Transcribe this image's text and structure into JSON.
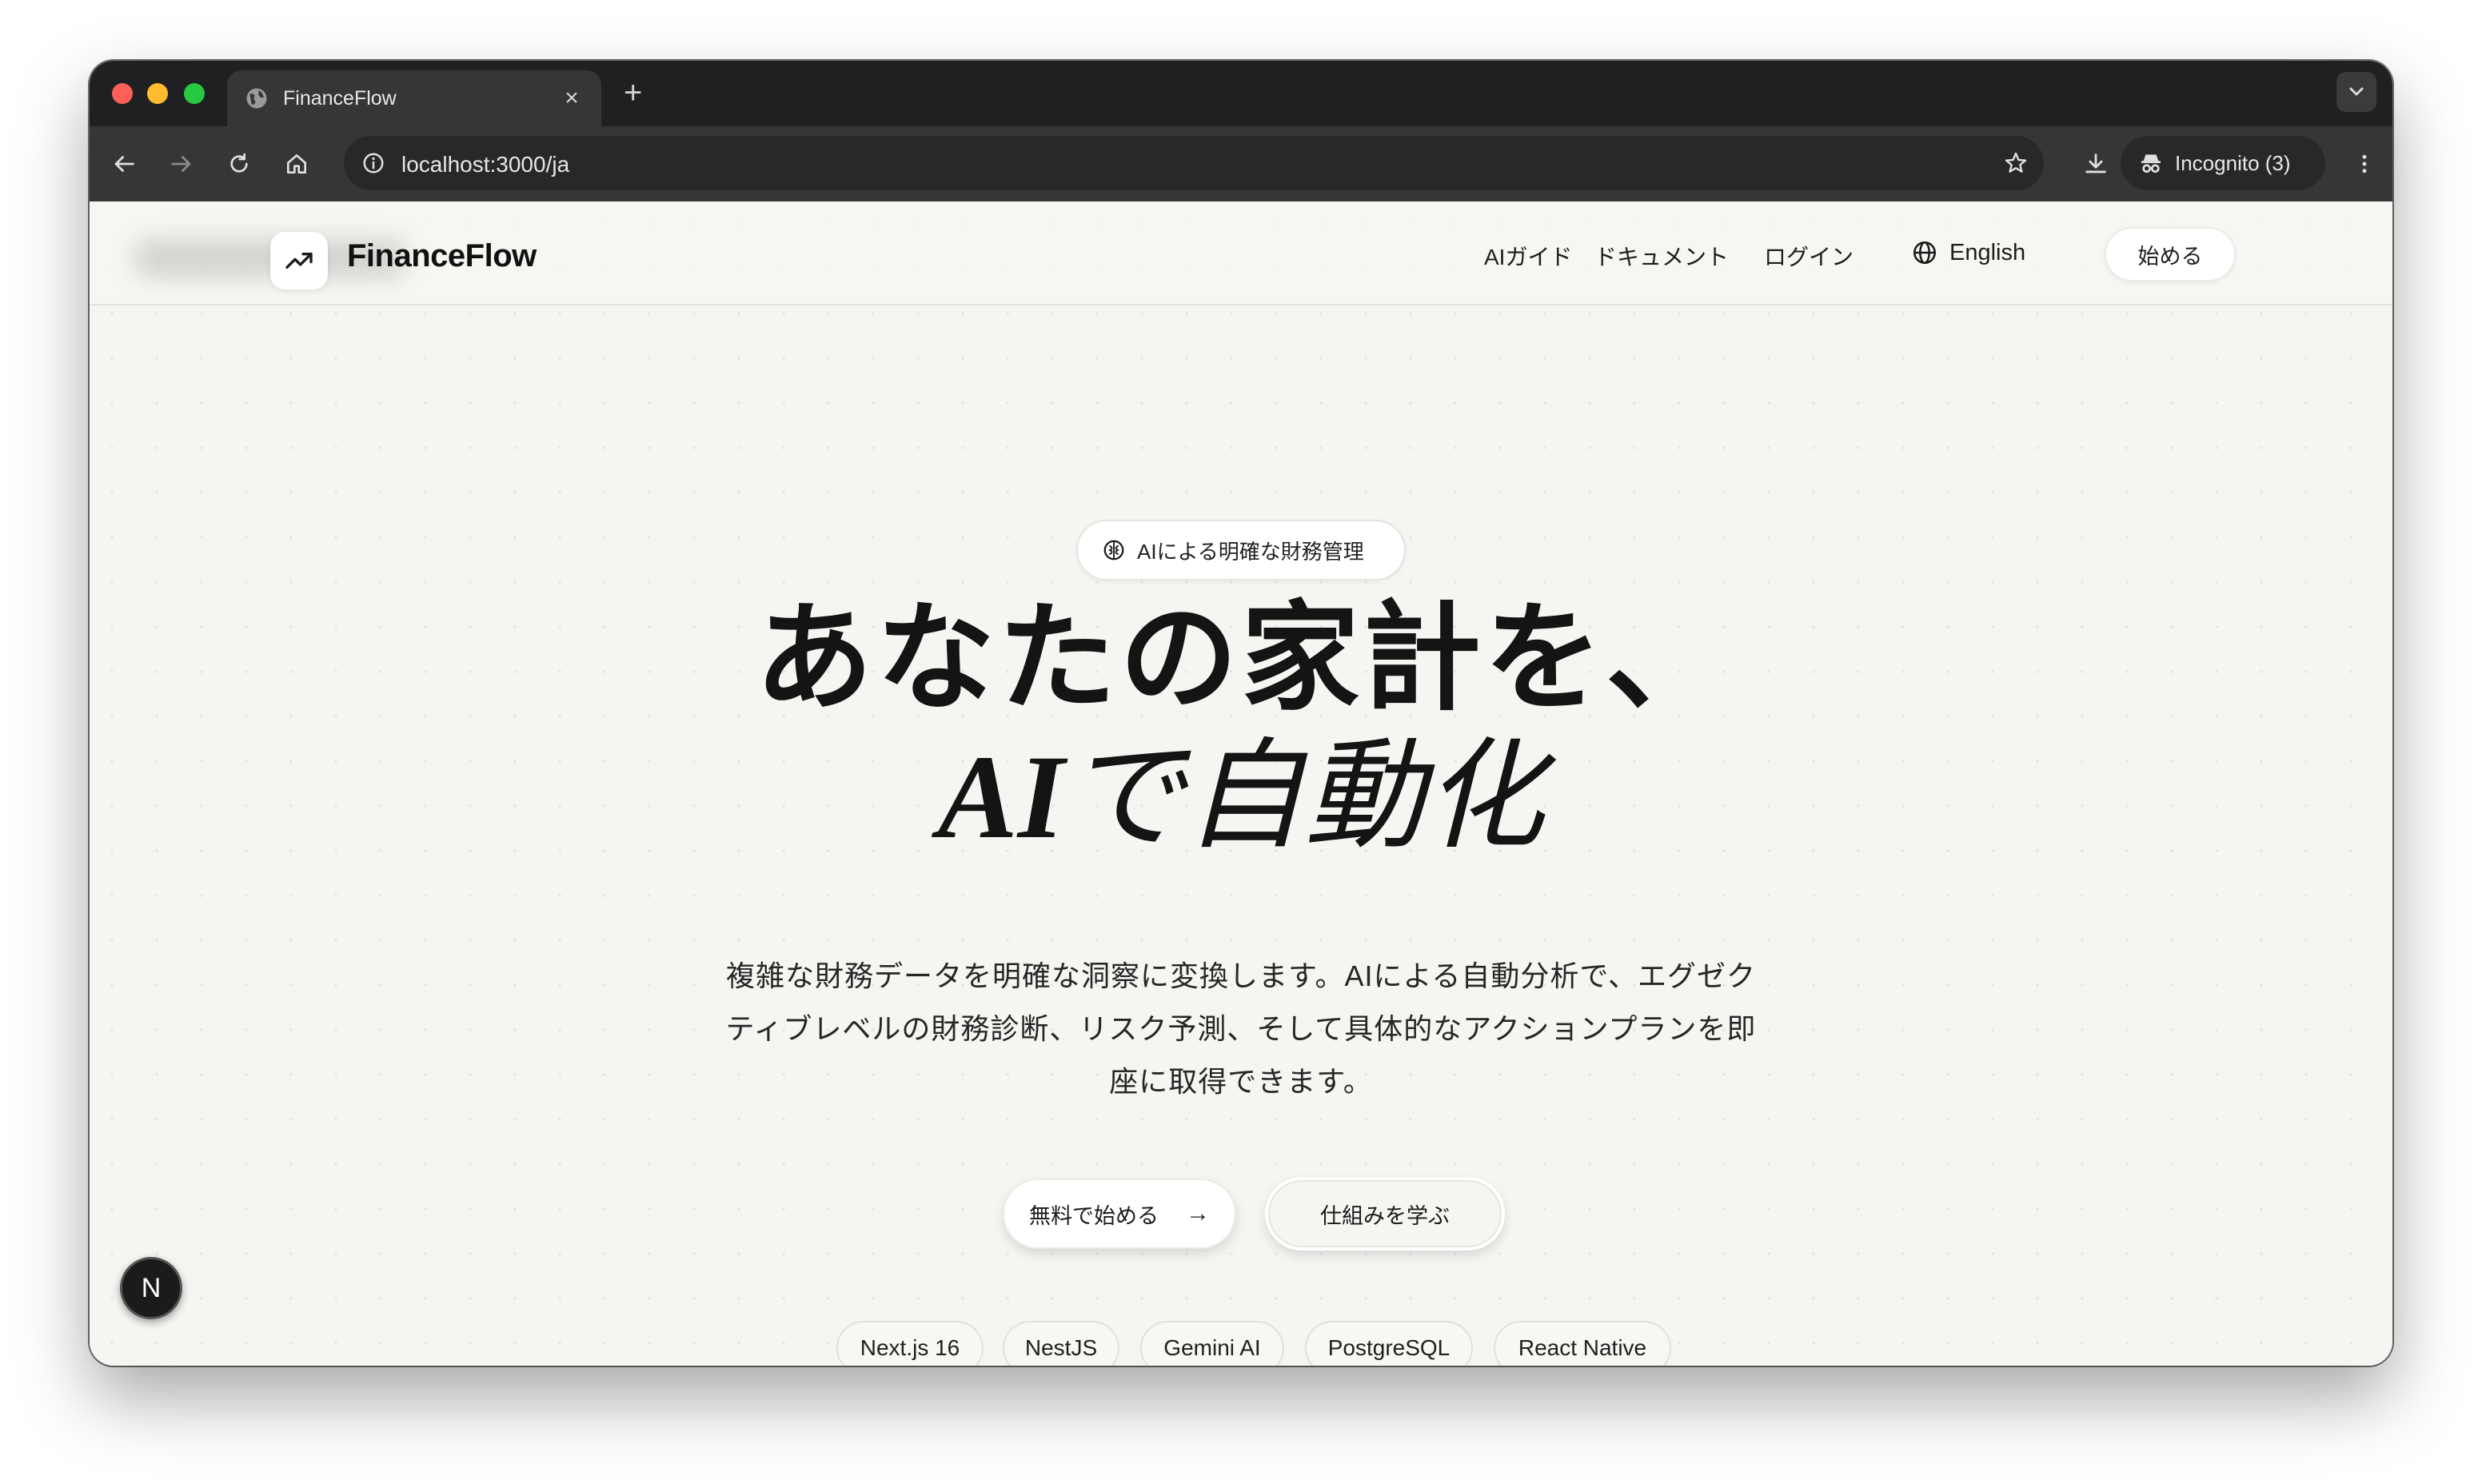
{
  "browser": {
    "tab_title": "FinanceFlow",
    "url": "localhost:3000/ja",
    "incognito_label": "Incognito (3)",
    "new_tab": "+",
    "tab_close": "×"
  },
  "nav": {
    "logo": "FinanceFlow",
    "links": [
      "AIガイド",
      "ドキュメント",
      "ログイン"
    ],
    "language": "English",
    "start": "始める"
  },
  "hero": {
    "badge": "AIによる明確な財務管理",
    "title_line1": "あなたの家計を、",
    "title_line2_latin": "AI",
    "title_line2_jp": "で自動化",
    "subtitle_lines": [
      "複雑な財務データを明確な洞察に変換します。AIによる自動分析で、エグゼク",
      "ティブレベルの財務診断、リスク予測、そして具体的なアクションプランを即",
      "座に取得できます。"
    ],
    "cta_primary": "無料で始める",
    "cta_primary_arrow": "→",
    "cta_secondary": "仕組みを学ぶ"
  },
  "tech_chips": [
    "Next.js 16",
    "NestJS",
    "Gemini AI",
    "PostgreSQL",
    "React Native"
  ],
  "dev_badge": "N",
  "colors": {
    "chrome_dark": "#1f2021",
    "toolbar": "#353637",
    "page_bg": "#f6f5f2",
    "text": "#141414",
    "traffic_red": "#ff5f57",
    "traffic_yellow": "#febc2e",
    "traffic_green": "#28c840"
  },
  "icons": {
    "tab": "globe-icon",
    "back": "arrow-left-icon",
    "forward": "arrow-right-icon",
    "reload": "reload-icon",
    "home": "home-icon",
    "site_info": "info-icon",
    "bookmark": "star-icon",
    "download": "download-icon",
    "incognito": "incognito-icon",
    "menu": "kebab-menu-icon",
    "logo": "trending-up-icon",
    "language": "globe-icon",
    "badge": "brain-icon"
  }
}
